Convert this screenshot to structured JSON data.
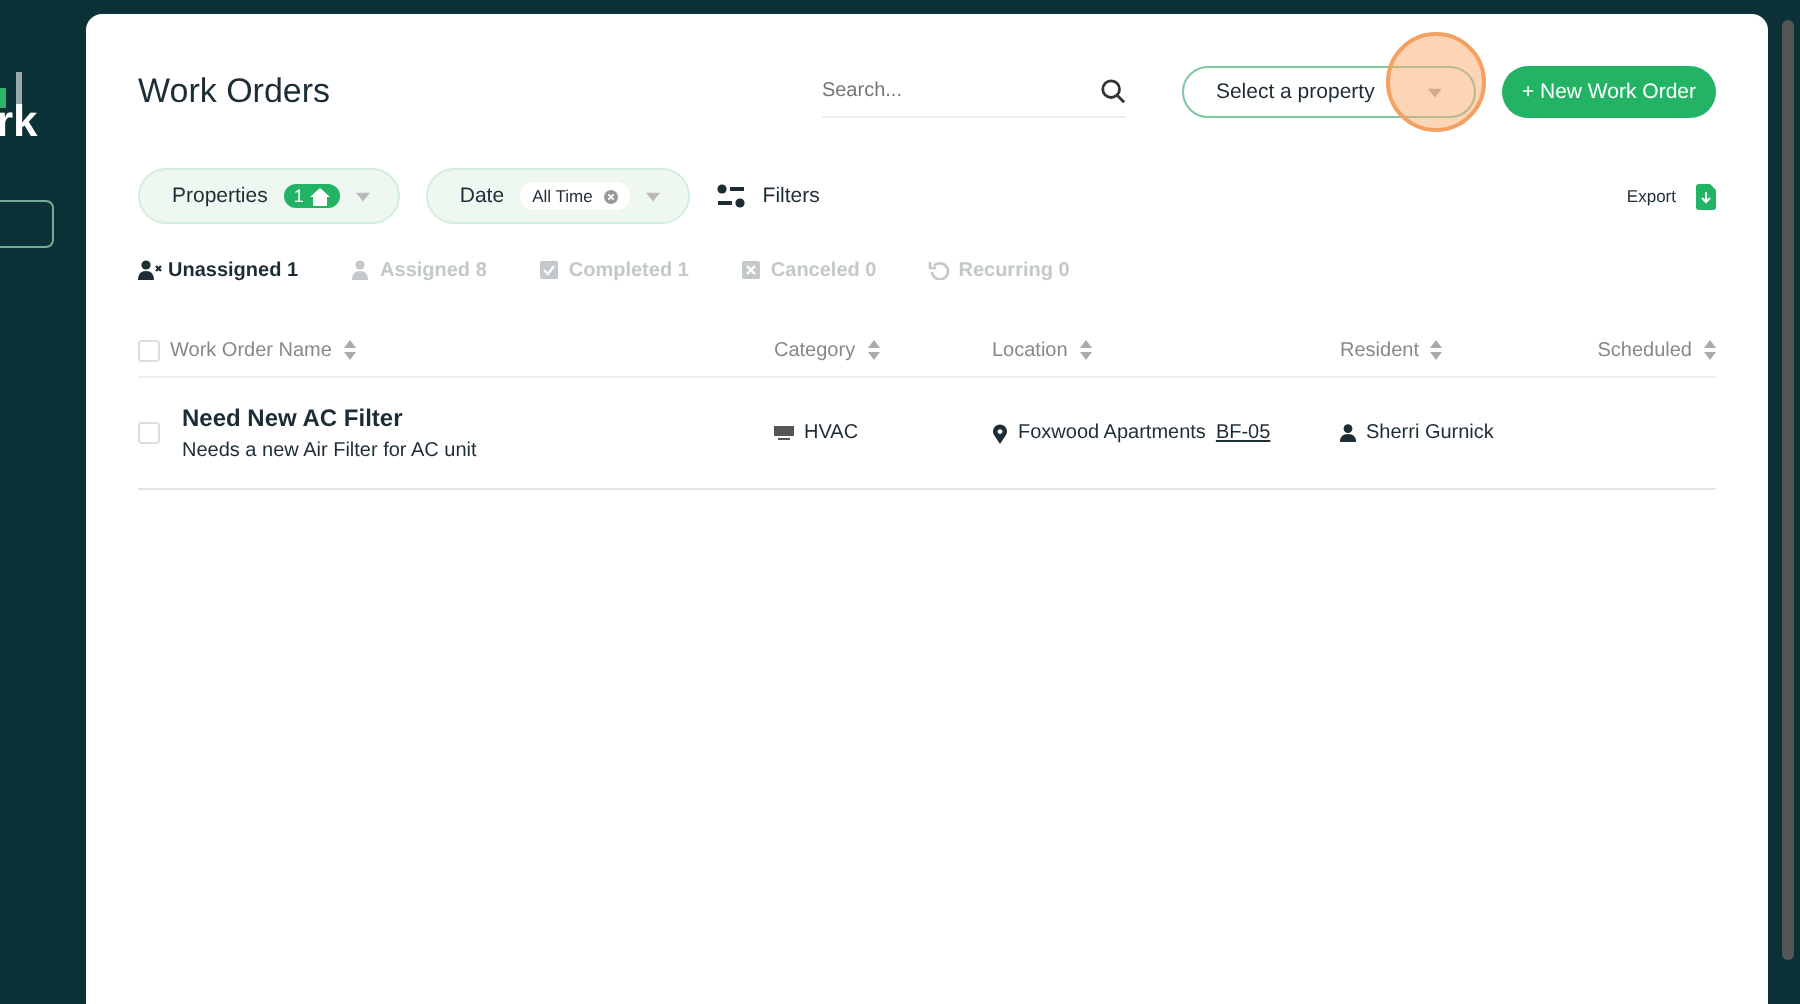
{
  "sidebar": {
    "logo_text": "rk"
  },
  "page": {
    "title": "Work Orders",
    "search": {
      "placeholder": "Search..."
    },
    "property_select": {
      "placeholder": "Select a property"
    },
    "new_button": "+ New Work Order"
  },
  "filters": {
    "properties": {
      "label": "Properties",
      "count": "1"
    },
    "date": {
      "label": "Date",
      "value": "All Time"
    },
    "filters_label": "Filters",
    "export_label": "Export"
  },
  "tabs": [
    {
      "label": "Unassigned 1",
      "kind": "person-x",
      "selected": true
    },
    {
      "label": "Assigned 8",
      "kind": "person",
      "selected": false
    },
    {
      "label": "Completed 1",
      "kind": "check",
      "selected": false
    },
    {
      "label": "Canceled 0",
      "kind": "cross",
      "selected": false
    },
    {
      "label": "Recurring 0",
      "kind": "recur",
      "selected": false
    }
  ],
  "table": {
    "select_all_checked": false,
    "columns": [
      "Work Order Name",
      "Category",
      "Location",
      "Resident",
      "Scheduled"
    ],
    "rows": [
      {
        "title": "Need New AC Filter",
        "description": "Needs a new Air Filter for AC unit",
        "category": "HVAC",
        "location": "Foxwood Apartments",
        "unit": "BF-05",
        "resident": "Sherri Gurnick",
        "checked": false
      }
    ]
  }
}
